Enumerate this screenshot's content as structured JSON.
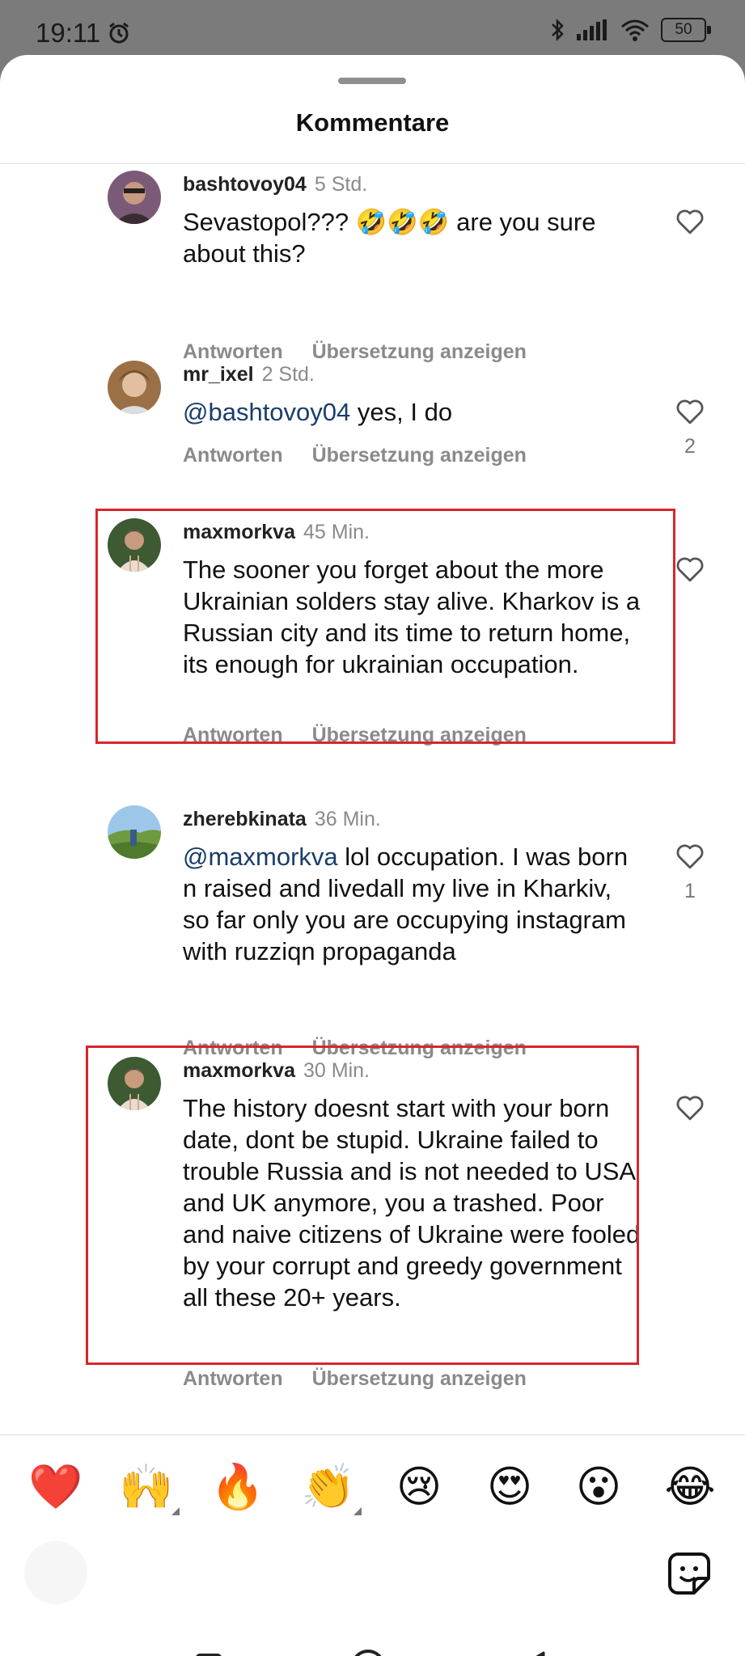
{
  "status_bar": {
    "time": "19:11",
    "battery": "50",
    "icons": [
      "alarm-icon",
      "bluetooth-icon",
      "signal-icon",
      "wifi-icon",
      "battery-icon"
    ]
  },
  "sheet": {
    "title": "Kommentare"
  },
  "comments": [
    {
      "username": "bashtovoy04",
      "time": "5 Std.",
      "mention": "",
      "text": "Sevastopol??? 🤣🤣🤣 are you sure about this?",
      "reply_label": "Antworten",
      "translate_label": "Übersetzung anzeigen",
      "likes": ""
    },
    {
      "username": "mr_ixel",
      "time": "2 Std.",
      "mention": "@bashtovoy04",
      "text": " yes, I do",
      "reply_label": "Antworten",
      "translate_label": "Übersetzung anzeigen",
      "likes": "2"
    },
    {
      "username": "maxmorkva",
      "time": "45 Min.",
      "mention": "",
      "text": "The sooner you forget about the more Ukrainian solders stay alive. Kharkov is a Russian city and its time to return home, its enough for ukrainian occupation.",
      "reply_label": "Antworten",
      "translate_label": "Übersetzung anzeigen",
      "likes": ""
    },
    {
      "username": "zherebkinata",
      "time": "36 Min.",
      "mention": "@maxmorkva",
      "text": " lol occupation. I was born n raised and livedall my live in Kharkiv, so far only you are occupying instagram with ruzziqn propaganda",
      "reply_label": "Antworten",
      "translate_label": "Übersetzung anzeigen",
      "likes": "1"
    },
    {
      "username": "maxmorkva",
      "time": "30 Min.",
      "mention": "",
      "text": "The history doesnt start with your born date, dont be stupid. Ukraine failed to trouble Russia and is not needed to USA and UK anymore, you a trashed. Poor and naive citizens of Ukraine were fooled by your corrupt and greedy government all these 20+ years.",
      "reply_label": "Antworten",
      "translate_label": "Übersetzung anzeigen",
      "likes": ""
    }
  ],
  "emoji_bar": [
    "❤️",
    "🙌",
    "🔥",
    "👏",
    "😢",
    "😍",
    "😮",
    "😂"
  ],
  "colors": {
    "highlight": "#d8262c",
    "mention": "#1a3d6b",
    "muted": "#8a8a8a"
  }
}
